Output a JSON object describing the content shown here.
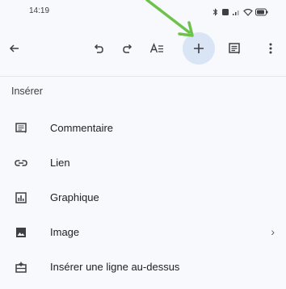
{
  "status_bar": {
    "time": "14:19",
    "icons": [
      "bluetooth-icon",
      "notification-icon",
      "signal-icon",
      "wifi-icon",
      "battery-icon"
    ]
  },
  "toolbar": {
    "buttons": [
      {
        "name": "back",
        "icon": "arrow-left-icon"
      },
      {
        "name": "undo",
        "icon": "undo-icon"
      },
      {
        "name": "redo",
        "icon": "redo-icon"
      },
      {
        "name": "text-format",
        "icon": "text-format-icon"
      },
      {
        "name": "insert",
        "icon": "plus-icon",
        "active": true
      },
      {
        "name": "comment",
        "icon": "comment-icon"
      },
      {
        "name": "more",
        "icon": "more-vert-icon"
      }
    ]
  },
  "menu": {
    "title": "Insérer",
    "items": [
      {
        "label": "Commentaire",
        "icon": "comment-icon"
      },
      {
        "label": "Lien",
        "icon": "link-icon"
      },
      {
        "label": "Graphique",
        "icon": "chart-icon"
      },
      {
        "label": "Image",
        "icon": "image-icon",
        "has_submenu": true,
        "chevron": "›"
      },
      {
        "label": "Insérer une ligne au-dessus",
        "icon": "insert-row-above-icon"
      }
    ]
  },
  "colors": {
    "background": "#f7f9fc",
    "accent_circle": "#d9e4f5",
    "annotation_arrow": "#6cc24a",
    "text": "#202124",
    "icon": "#3c4043"
  }
}
